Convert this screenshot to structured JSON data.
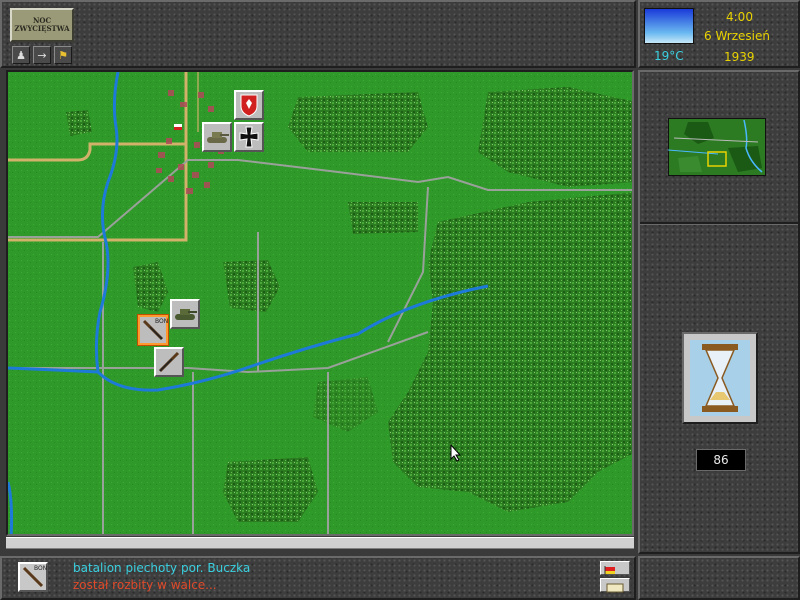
{
  "header": {
    "logo_text": "NOC ZWYCIĘSTWA",
    "buttons": [
      {
        "name": "unit-info-button",
        "icon": "soldier-icon"
      },
      {
        "name": "move-arrow-button",
        "icon": "arrow-right-icon"
      },
      {
        "name": "attack-button",
        "icon": "flag-icon"
      }
    ]
  },
  "clock": {
    "time": "4:00",
    "date": "6 Wrzesień",
    "year": "1939",
    "temperature": "19°C",
    "weather_icon": "clear-sky-icon"
  },
  "side_panel": {
    "turns_left": "86",
    "end_turn_icon": "hourglass-icon"
  },
  "message": {
    "line1": "batalion piechoty por. Buczka",
    "line2": "został rozbity w walce...",
    "line1_color": "#3ad0e0",
    "line2_color": "#e04a2a",
    "unit_label": "BON"
  },
  "units": [
    {
      "name": "polish-eagle-hq-counter",
      "icon": "white-eagle-icon"
    },
    {
      "name": "german-tank-counter",
      "icon": "tank-icon"
    },
    {
      "name": "german-cross-counter",
      "icon": "iron-cross-icon"
    },
    {
      "name": "selected-infantry-counter",
      "icon": "rifle-icon",
      "label": "BON"
    },
    {
      "name": "polish-tank-counter",
      "icon": "tank-icon"
    },
    {
      "name": "polish-infantry-counter",
      "icon": "rifle-icon"
    }
  ],
  "colors": {
    "grass": "#2f9a2a",
    "forest": "#2a7a1e",
    "river": "#1e7ad8",
    "road": "#a0a0a0",
    "rail": "#d2b26a",
    "text_yellow": "#e8d200"
  }
}
